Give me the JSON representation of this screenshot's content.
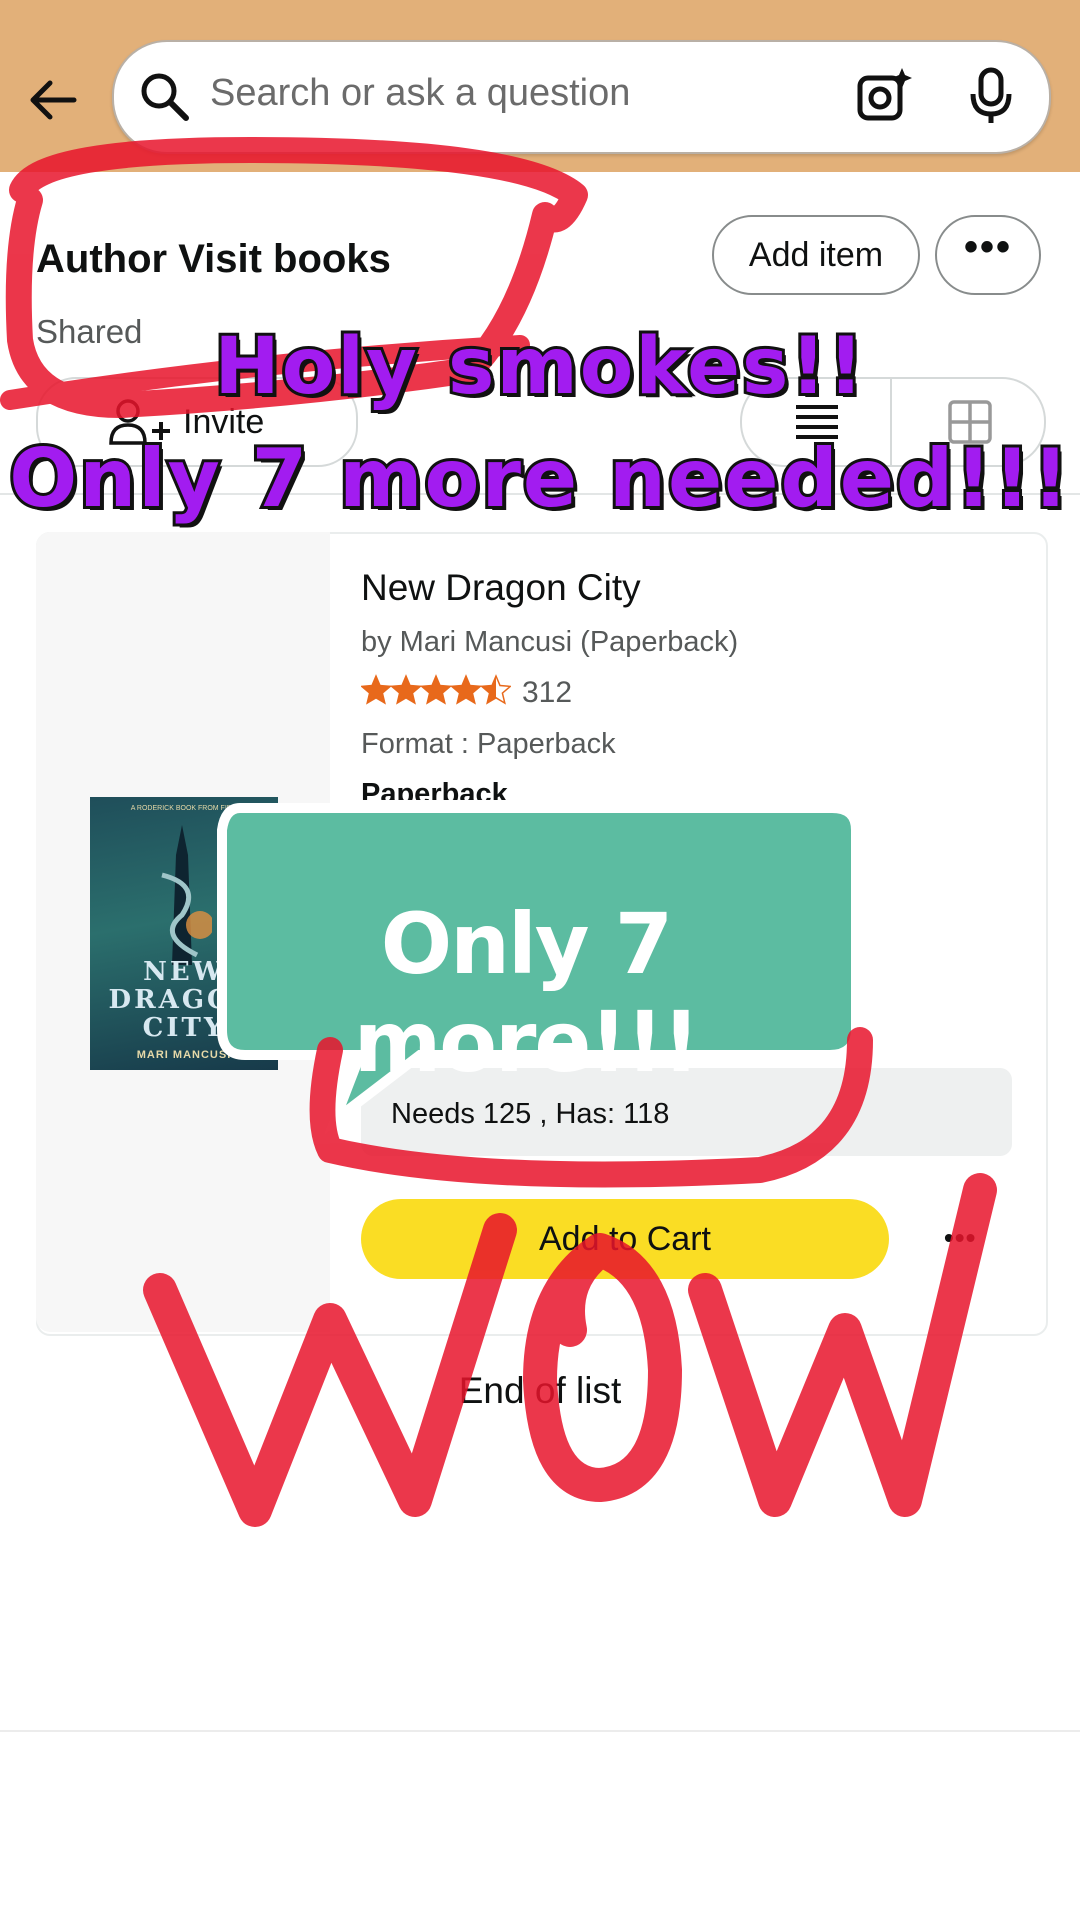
{
  "search": {
    "placeholder": "Search or ask a question"
  },
  "list": {
    "title": "Author Visit books",
    "subtitle": "Shared",
    "add_item_label": "Add item",
    "more_label": "•••",
    "invite_label": "Invite"
  },
  "item": {
    "title": "New Dragon City",
    "author": "by Mari Mancusi (Paperback)",
    "rating_stars": 4.5,
    "rating_count": "312",
    "format": "Format : Paperback",
    "format_detail": "Paperback",
    "needs": "Needs 125 , Has: 118",
    "add_to_cart_label": "Add to Cart",
    "more_label": "•••",
    "cover": {
      "top_line": "A RODERICK BOOK FROM FIDO",
      "line1": "NEW",
      "line2": "DRAGON",
      "line3": "CITY",
      "author": "MARI MANCUSI"
    }
  },
  "end_of_list": "End of list",
  "overlays": {
    "caption_line1": "Holy smokes!!",
    "caption_line2": "Only 7 more needed!!!",
    "bubble_text": "Only 7 more!!!",
    "handwriting": "WOW"
  },
  "colors": {
    "header_bg": "#e2b079",
    "cart_button": "#fadd24",
    "caption_purple": "#a21cf0",
    "bubble_green": "#5cbca1",
    "marker_red": "#e8142b",
    "star_orange": "#e8691b"
  }
}
